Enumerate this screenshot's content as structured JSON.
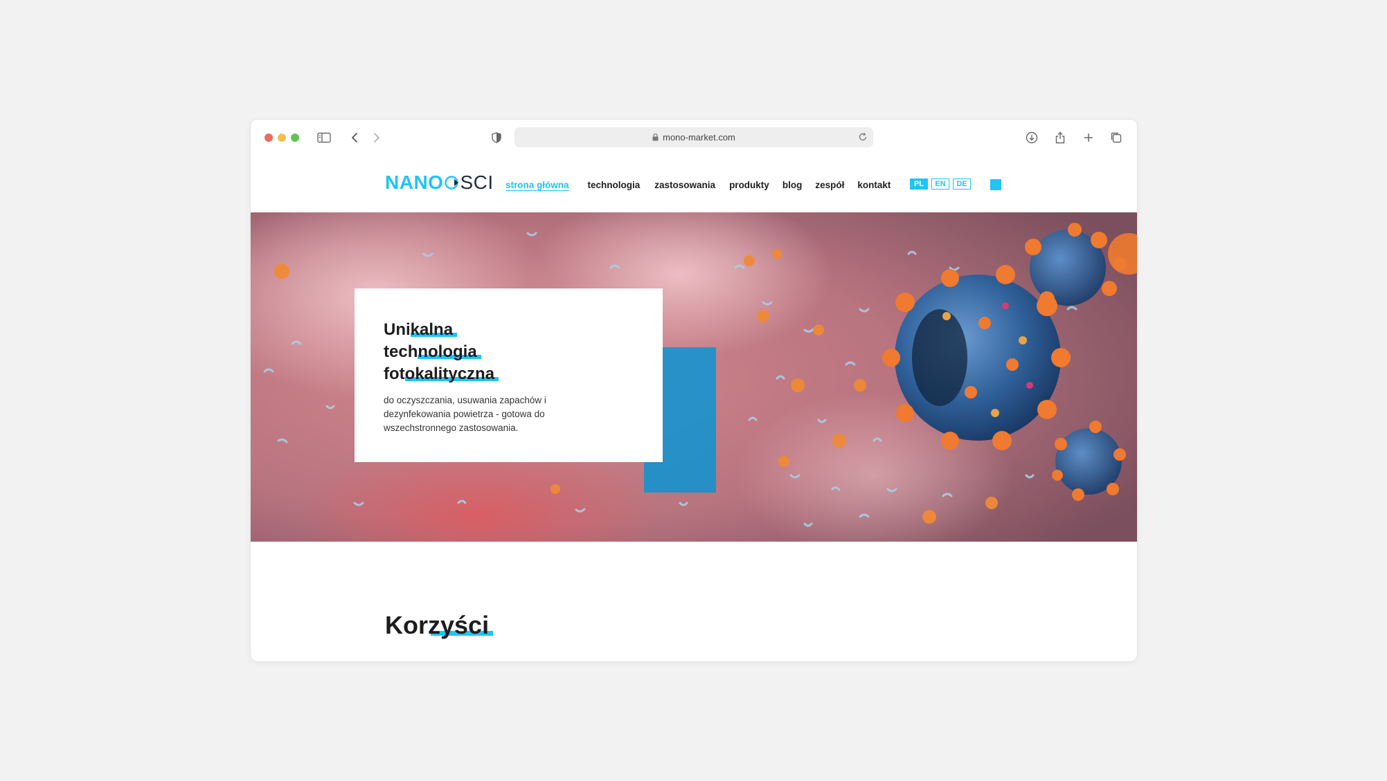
{
  "browser": {
    "url": "mono-market.com",
    "icons": [
      "sidebar-icon",
      "back-icon",
      "forward-icon",
      "shield-icon",
      "lock-icon",
      "reload-icon",
      "download-icon",
      "share-icon",
      "new-tab-icon",
      "tabs-overview-icon"
    ]
  },
  "site": {
    "logo": {
      "part1": "NANO",
      "part2": "SCI"
    },
    "nav": [
      {
        "label": "strona główna",
        "active": true
      },
      {
        "label": "technologia"
      },
      {
        "label": "zastosowania"
      },
      {
        "label": "produkty"
      },
      {
        "label": "blog"
      },
      {
        "label": "zespół"
      },
      {
        "label": "kontakt"
      }
    ],
    "languages": [
      {
        "code": "PL",
        "active": true
      },
      {
        "code": "EN"
      },
      {
        "code": "DE"
      }
    ],
    "colors": {
      "accent": "#1ec5f5",
      "text": "#1d1d1d"
    }
  },
  "hero": {
    "title_prefix": [
      "Uni",
      "tech",
      "fot"
    ],
    "title_highlight": [
      "kalna",
      "nologia",
      "okalityczna"
    ],
    "description": "do oczyszczania, usuwania zapachów  i dezynfekowania powietrza -  gotowa do wszechstronnego zastosowania."
  },
  "section": {
    "title_prefix": "Kor",
    "title_highlight": "zyści"
  }
}
